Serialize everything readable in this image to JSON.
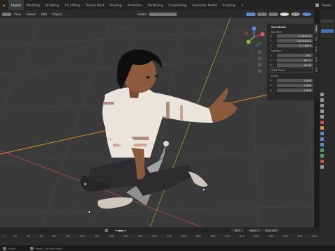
{
  "workspaces": [
    "Layout",
    "Modeling",
    "Sculpting",
    "UV Editing",
    "Texture Paint",
    "Shading",
    "Animation",
    "Rendering",
    "Compositing",
    "Geometry Nodes",
    "Scripting"
  ],
  "active_workspace": "Layout",
  "scene_label": "Scene",
  "viewport_header": {
    "mode": "Object Mode",
    "view": "View",
    "select": "Select",
    "add": "Add",
    "object": "Object",
    "orientation": "Global",
    "options": "Options"
  },
  "npanel": {
    "title": "Transform",
    "location_label": "Location",
    "location": {
      "x": "2.2675 m",
      "y": "0.07943 m",
      "z": "1.1726 m"
    },
    "rotation_label": "Rotation",
    "rotation": {
      "x": "270°",
      "y": "90.7°",
      "z": "94.6°"
    },
    "rotation_mode": "XYZ Euler",
    "scale_label": "Scale",
    "scale": {
      "x": "1.000",
      "y": "1.000",
      "z": "1.000"
    },
    "tabs": [
      "Item",
      "Tool",
      "View",
      "Edit",
      "ARP"
    ]
  },
  "timeline": {
    "current_frame": "679",
    "start_label": "Start",
    "start": "1",
    "end_label": "End",
    "end": "250",
    "ruler": [
      "0",
      "20",
      "40",
      "60",
      "80",
      "100",
      "120",
      "140",
      "160",
      "180",
      "200",
      "220",
      "240",
      "260",
      "280",
      "300",
      "320",
      "340",
      "360",
      "380",
      "400",
      "420",
      "440"
    ]
  },
  "status": {
    "hint": "Object Context Menu",
    "left": "Select"
  },
  "colors": {
    "viewport": "#3a3a3a",
    "grid": "#434343",
    "x_axis": "#a8494f",
    "y_axis": "#7f9a3a",
    "orange": "#e8922c",
    "header": "#2b2b2b"
  },
  "icons": [
    "blender-logo-icon",
    "editor-type-icon",
    "gizmo-icon",
    "zoom-icon",
    "hand-icon",
    "camera-icon",
    "grid-icon",
    "play-icon",
    "jump-start-icon",
    "jump-end-icon",
    "keyframe-icon",
    "shading-solid-icon",
    "shading-material-icon",
    "shading-rendered-icon"
  ]
}
